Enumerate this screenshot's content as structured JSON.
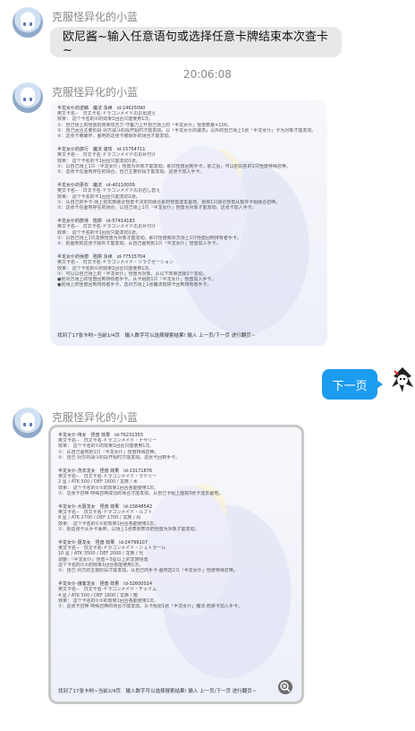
{
  "sender_name": "克服怪异化的小蓝",
  "messages": {
    "first_text": "欧尼酱~输入任意语句或选择任意卡牌结束本次查卡~",
    "timestamp": "20:06:08",
    "next_button": "下一页"
  },
  "card1": {
    "entries": [
      {
        "head": "半龙女仆的逆鳞　魔法 永续　id-14625090",
        "lines": [
          "英文卡名--　日文卡名-ドラゴンメイドのお出迎え",
          "效果： 这个卡名的②的效果1回合只能使用1次。",
          "①：自己场上的怪兽的效果攻击力·守备力上升自己场上的「半龙女仆」怪兽数量×100。",
          "②：自己回合主要阶段·对方战斗阶段开始时才能发动。以「半龙女仆的姿态」以外的自己场上1张「半龙女仆」卡为对象才能发动。",
          "③：这张卡被破坏、墓地的这张卡被除外的场合才能发动。"
        ]
      },
      {
        "head": "半龙女仆的旅行　魔法 速攻　id-15754711",
        "lines": [
          "英文卡名--　日文卡名-ドラゴンメイドのお片付け",
          "效果： 这个卡名的卡1回合只能发动1张。",
          "①：以自己场上1只「半龙女仆」怪兽为对象才能发动。那只怪兽回到手卡，那之后，可以把同名的1只怪兽特殊召唤。",
          "②：这张卡在墓地存在的场合，自己主要阶段才能发动。这张卡加入手卡。"
        ]
      },
      {
        "head": "半龙女仆的更衣　魔法　id-40110009",
        "lines": [
          "英文卡名--　日文卡名-ドラゴンメイドのお召し替え",
          "效果： 这个卡名的卡1回合只能发动1张。",
          "①：从自己的手卡·场上把龙族融合怪兽卡决定的融合素材怪兽送去墓地，把那1只融合怪兽从额外卡组融合召唤。",
          "②：这张卡在墓地存在的场合，以自己场上1只「半龙女仆」怪兽为对象才能发动。这张卡加入手卡。"
        ]
      },
      {
        "head": "半龙女仆的款待　陷阱　id-57414183",
        "lines": [
          "英文卡名--　日文卡名-ドラゴンメイドのお片付け",
          "效果： 这个卡名的卡1回合只能发动1张。",
          "①：以自己场上1只龙族怪兽为对象才能发动。那只怪兽和对方场上1只怪兽回到持有者手卡。",
          "②：把墓地的这张卡除外才能发动。从自己墓地把1只「半龙女仆」怪兽加入手卡。"
        ]
      },
      {
        "head": "半龙女仆的休憩　陷阱 永续　id-77515704",
        "lines": [
          "英文卡名--　日文卡名-ドラゴンメイド・リラクゼーション",
          "效果： 这个卡名的①的效果1回合只能使用1次。",
          "①：可以以自己场上的「半龙女仆」怪兽为对象，从以下效果选择1个发动。",
          "●把对方场上的怪兽回到持有者手卡。从卡组把1只「半龙女仆」怪兽加入手卡。",
          "●把场上的怪兽回到持有者手卡，选对方场上1张魔法陷阱卡回到持有者手卡。"
        ]
      }
    ],
    "footer": "找到了17张卡哟~当前1/4页　输入数字可以选择搜索结果! 输入 上一页/下一页 进行翻页~"
  },
  "card2": {
    "entries": [
      {
        "head": "半龙女仆·侍女　怪兽 效果　id-76231355",
        "lines": [
          "英文卡名--　日文卡名-ドラゴンメイド・ナサリー",
          "效果： 这个卡名的①的效果1回合只能使用1次。",
          "①：从自己墓地把1只「半龙女仆」怪兽特殊召唤。",
          "②：自己·对方的战斗阶段开始时才能发动。这张卡回到手卡。"
        ]
      },
      {
        "head": "半龙女仆·洗衣龙女　怪兽 效果　id-13171876",
        "lines": [
          "英文卡名--　日文卡名-ドラゴンメイド・ラドリー",
          "2 星 / ATK 500 / DEF 1600 / 龙族 / 水",
          "效果： 这个卡名的①②的效果1回合各能使用1次。",
          "①：这张卡召唤·特殊召唤成功的场合才能发动。从自己卡组上面把3张卡送去墓地。"
        ]
      },
      {
        "head": "半龙女仆·大厨龙女　怪兽 效果　id-15848542",
        "lines": [
          "英文卡名--　日文卡名-ドラゴンメイド・ルフト",
          "8 星 / ATK 2700 / DEF 1700 / 龙族 / 风",
          "效果： 这个卡名的①②的效果1回合各能使用1次。",
          "①：把这张卡从手卡丢弃，以场上1张表侧表示的怪兽为对象才能发动。"
        ]
      },
      {
        "head": "半龙女仆·厨龙女　怪兽 效果　id-24799107",
        "lines": [
          "英文卡名--　日文卡名-ドラゴンメイド・シュトラール",
          "10 星 / ATK 3500 / DEF 2000 / 龙族 / 光",
          "调整：「半龙女仆」怪兽＋5星以上的龙族怪兽",
          "这个卡名的①②的效果1回合各能使用1次。",
          "①：自己·对方的主要阶段才能发动。从自己的手卡·墓地选1只「半龙女仆」怪兽特殊召唤。"
        ]
      },
      {
        "head": "半龙女仆·接客龙女　怪兽 效果　id-32600024",
        "lines": [
          "英文卡名--　日文卡名-ドラゴンメイド・チェイム",
          "4 星 / ATK 500 / DEF 1800 / 龙族 / 暗",
          "效果： 这个卡名的①②的效果1回合各能使用1次。",
          "①：这张卡召唤·特殊召唤的场合才能发动。从卡组把1张「半龙女仆」魔法·陷阱卡加入手卡。"
        ]
      }
    ],
    "footer": "找到了17张卡哟~当前2/4页　输入数字可以选择搜索结果! 输入 上一页/下一页 进行翻页~"
  }
}
